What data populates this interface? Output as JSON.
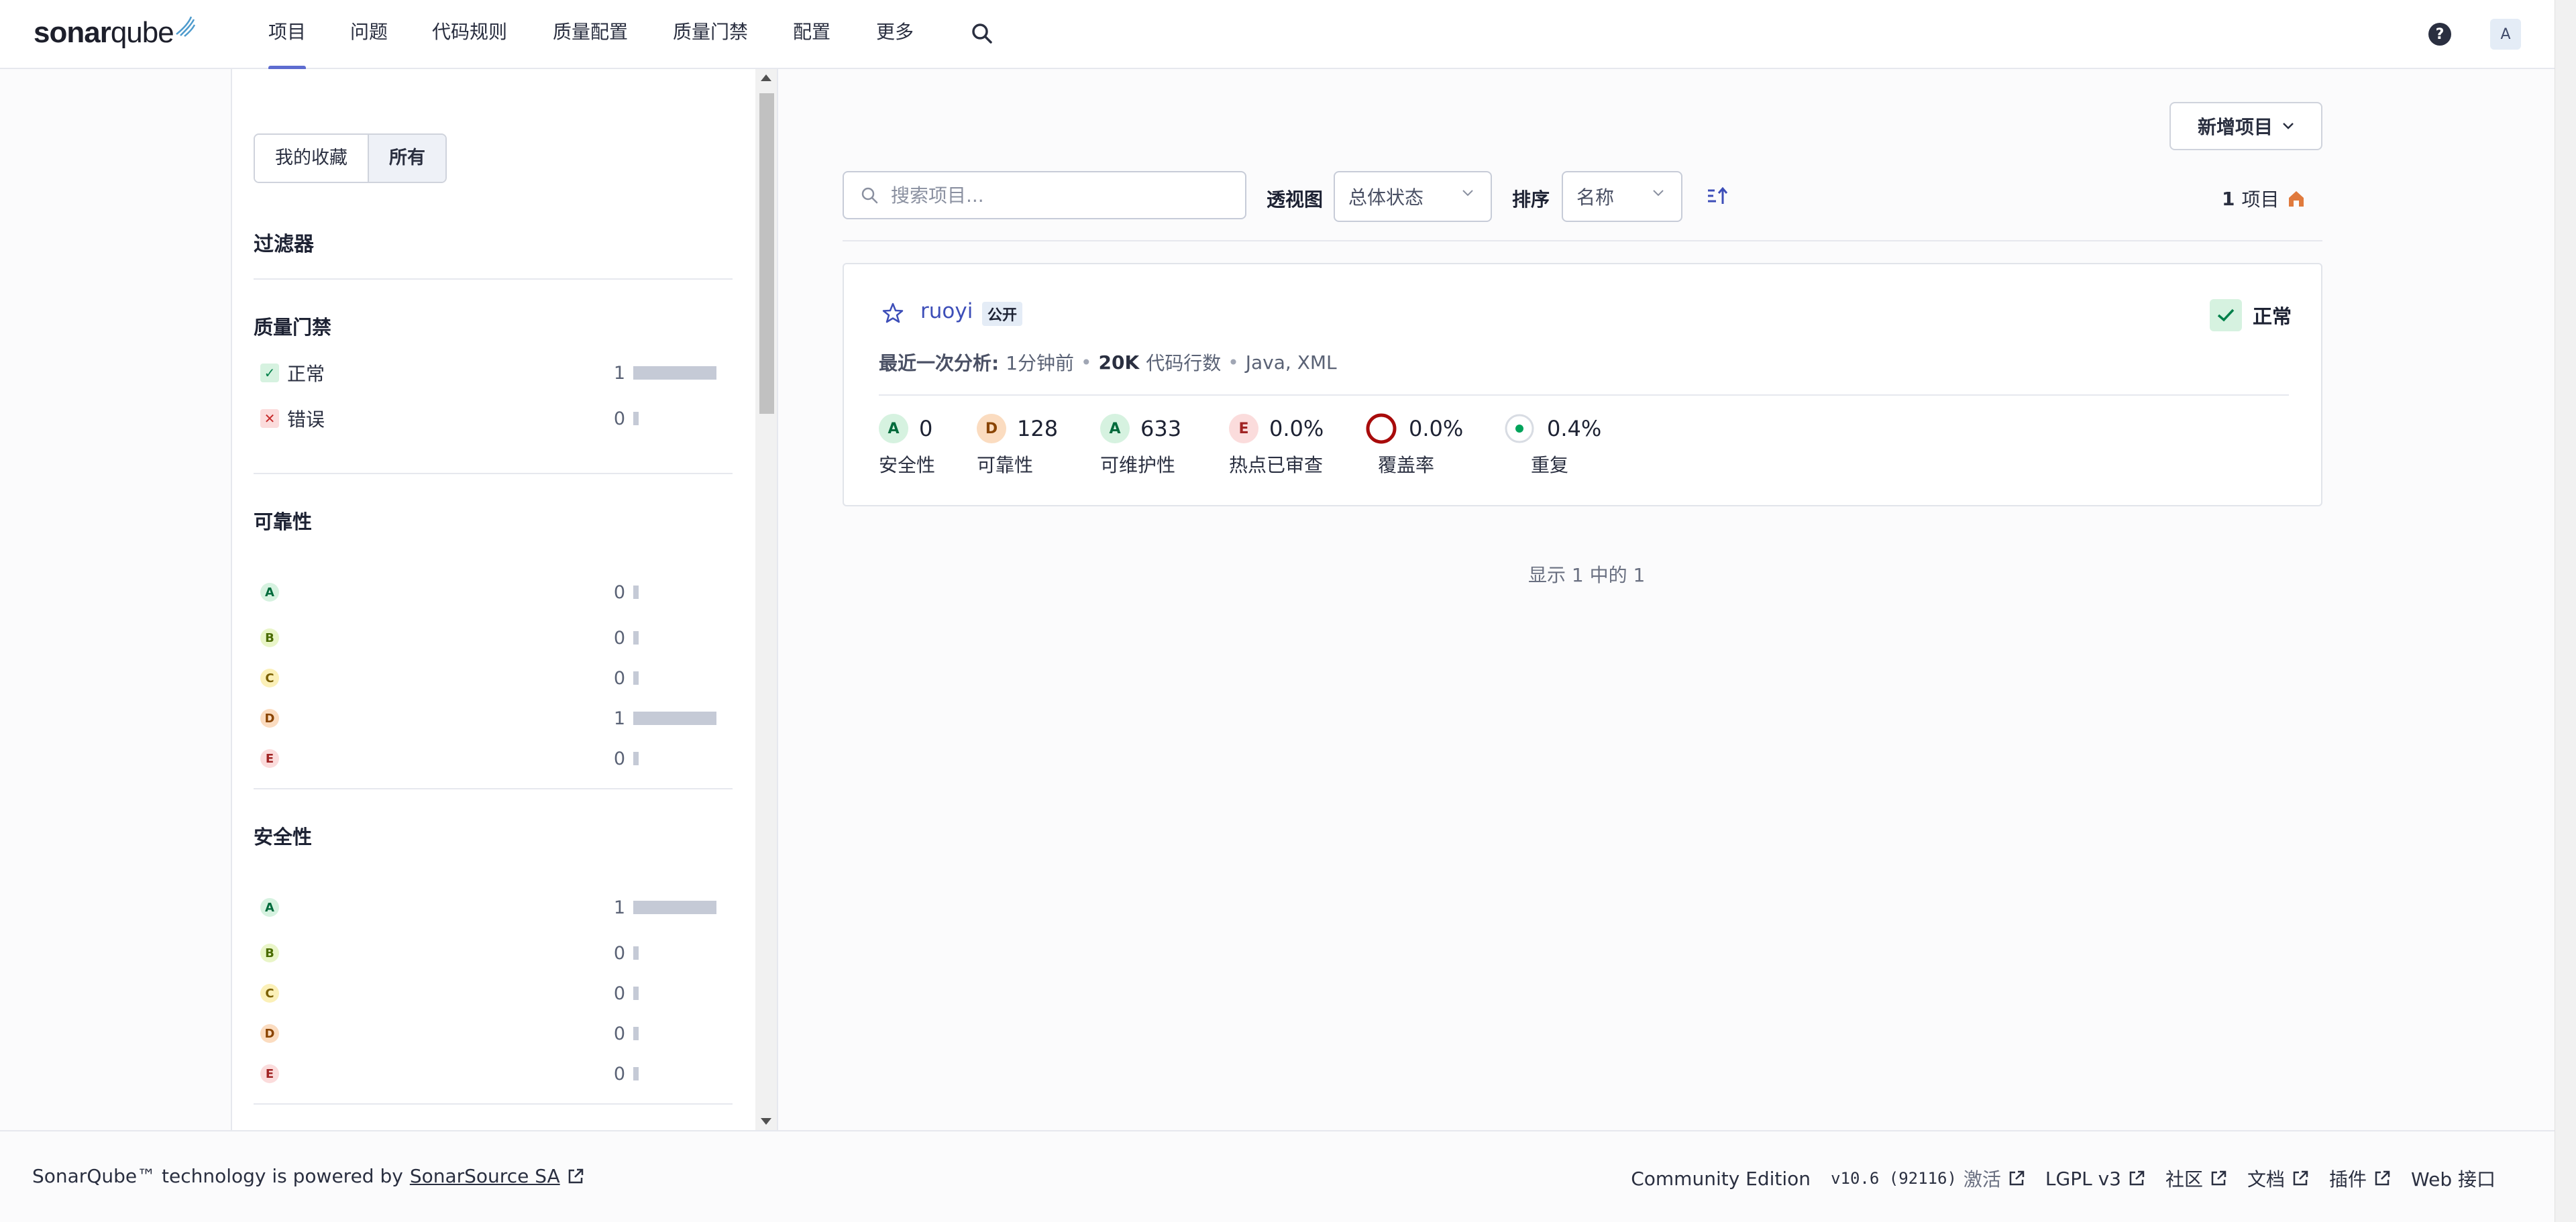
{
  "nav": {
    "logo": {
      "text_bold": "sonar",
      "text_light": "qube"
    },
    "items": [
      {
        "label": "项目",
        "active": true
      },
      {
        "label": "问题"
      },
      {
        "label": "代码规则"
      },
      {
        "label": "质量配置"
      },
      {
        "label": "质量门禁"
      },
      {
        "label": "配置"
      },
      {
        "label": "更多"
      }
    ],
    "help_label": "?",
    "avatar_label": "A"
  },
  "sidebar": {
    "toggle": {
      "favorites": "我的收藏",
      "all": "所有"
    },
    "filters_title": "过滤器",
    "quality_gate": {
      "title": "质量门禁",
      "items": [
        {
          "icon": "✓",
          "label": "正常",
          "count": "1",
          "fraction": 1
        },
        {
          "icon": "✕",
          "label": "错误",
          "count": "0",
          "fraction": 0
        }
      ]
    },
    "reliability": {
      "title": "可靠性",
      "items": [
        {
          "rating": "A",
          "count": "0",
          "fraction": 0
        },
        {
          "rating": "B",
          "count": "0",
          "fraction": 0
        },
        {
          "rating": "C",
          "count": "0",
          "fraction": 0
        },
        {
          "rating": "D",
          "count": "1",
          "fraction": 1
        },
        {
          "rating": "E",
          "count": "0",
          "fraction": 0
        }
      ]
    },
    "security": {
      "title": "安全性",
      "items": [
        {
          "rating": "A",
          "count": "1",
          "fraction": 1
        },
        {
          "rating": "B",
          "count": "0",
          "fraction": 0
        },
        {
          "rating": "C",
          "count": "0",
          "fraction": 0
        },
        {
          "rating": "D",
          "count": "0",
          "fraction": 0
        },
        {
          "rating": "E",
          "count": "0",
          "fraction": 0
        }
      ]
    }
  },
  "main": {
    "new_project_label": "新增项目",
    "search_placeholder": "搜索项目...",
    "perspective_label": "透视图",
    "perspective_value": "总体状态",
    "sort_label": "排序",
    "sort_value": "名称",
    "sort_direction_icon": "≟↑",
    "project_count": "1",
    "project_count_unit": "项目",
    "pager_text": "显示 1 中的 1"
  },
  "project": {
    "name": "ruoyi",
    "visibility": "公开",
    "status": "正常",
    "meta_label": "最近一次分析:",
    "analyzed": "1分钟前",
    "loc_value": "20K",
    "loc_label": "代码行数",
    "languages": "Java, XML",
    "metrics": [
      {
        "rating": "A",
        "value": "0",
        "label": "安全性"
      },
      {
        "rating": "D",
        "value": "128",
        "label": "可靠性"
      },
      {
        "rating": "A",
        "value": "633",
        "label": "可维护性"
      },
      {
        "rating": "E",
        "value": "0.0%",
        "label": "热点已审查"
      },
      {
        "rating": "",
        "value": "0.0%",
        "label": "覆盖率"
      },
      {
        "rating": "",
        "value": "0.4%",
        "label": "重复"
      }
    ]
  },
  "footer": {
    "powered_prefix": "SonarQube™ technology is powered by",
    "powered_link": "SonarSource SA",
    "edition": "Community Edition",
    "version": "v10.6 (92116)",
    "activated": "激活",
    "license": "LGPL v3",
    "community": "社区",
    "docs": "文档",
    "plugins": "插件",
    "web_api": "Web 接口"
  },
  "colors": {
    "accent": "#5d6cd0",
    "link": "#3d4eb8",
    "ok": "#00804a",
    "error": "#c62a2a",
    "coverage_ring": "#a80b0b",
    "duplication_dot": "#00a35a"
  }
}
